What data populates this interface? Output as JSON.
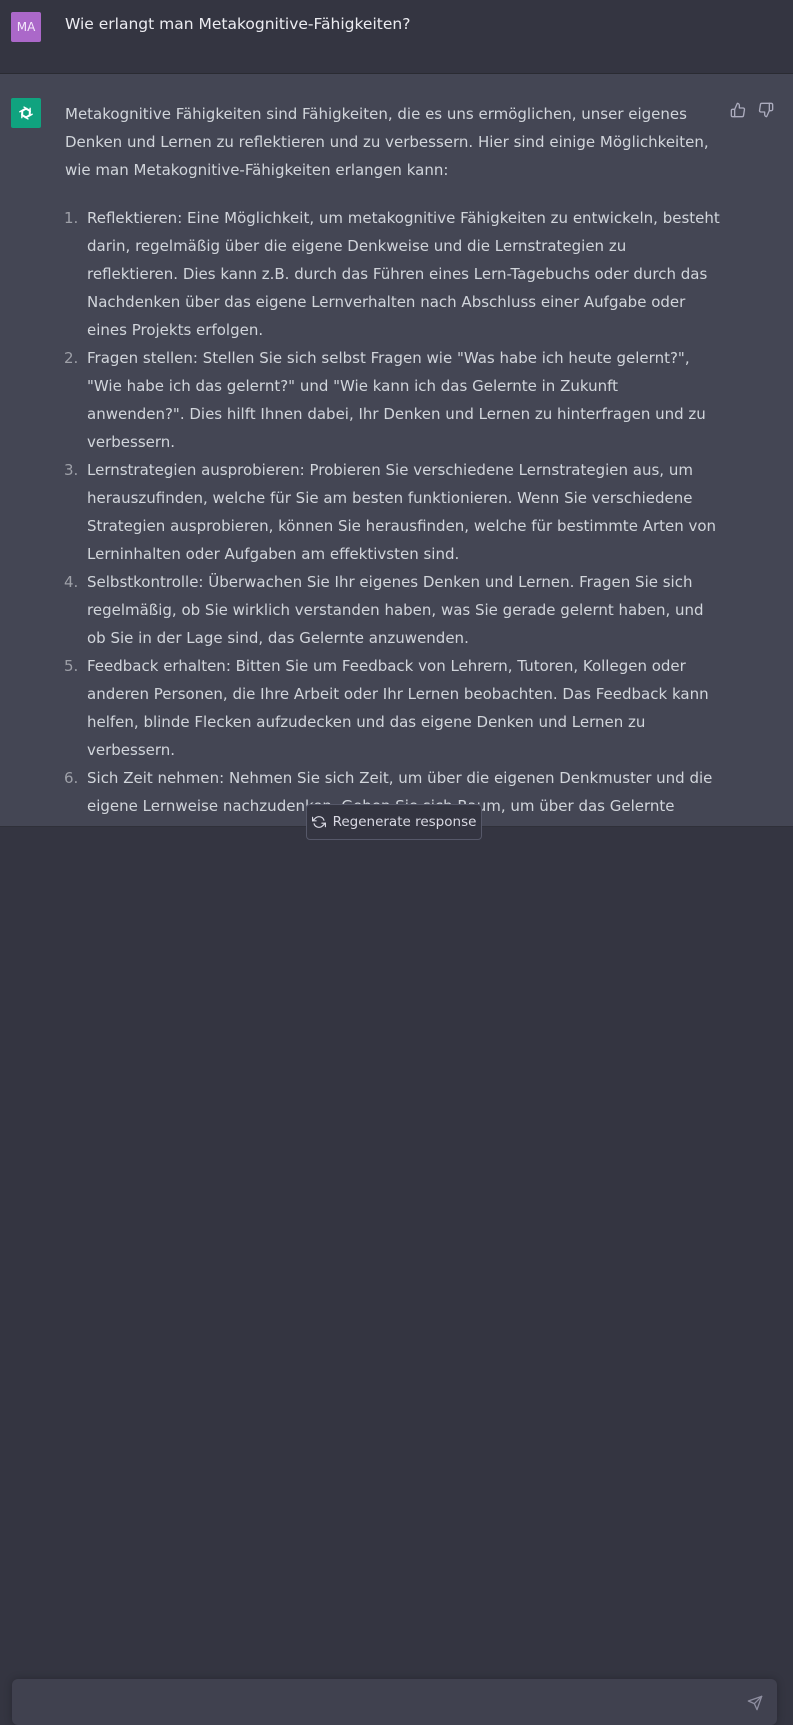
{
  "user": {
    "avatar_initials": "MA",
    "avatar_color": "#ab68c9",
    "message": "Wie erlangt man Metakognitive-Fähigkeiten?"
  },
  "assistant": {
    "avatar_icon": "openai-logo-icon",
    "avatar_color": "#10a37f",
    "intro": "Metakognitive Fähigkeiten sind Fähigkeiten, die es uns ermöglichen, unser eigenes Denken und Lernen zu reflektieren und zu verbessern. Hier sind einige Möglichkeiten, wie man Metakognitive-Fähigkeiten erlangen kann:",
    "items": [
      {
        "num": "1.",
        "text": "Reflektieren: Eine Möglichkeit, um metakognitive Fähigkeiten zu entwickeln, besteht darin, regelmäßig über die eigene Denkweise und die Lernstrategien zu reflektieren. Dies kann z.B. durch das Führen eines Lern-Tagebuchs oder durch das Nachdenken über das eigene Lernverhalten nach Abschluss einer Aufgabe oder eines Projekts erfolgen."
      },
      {
        "num": "2.",
        "text": "Fragen stellen: Stellen Sie sich selbst Fragen wie \"Was habe ich heute gelernt?\", \"Wie habe ich das gelernt?\" und \"Wie kann ich das Gelernte in Zukunft anwenden?\". Dies hilft Ihnen dabei, Ihr Denken und Lernen zu hinterfragen und zu verbessern."
      },
      {
        "num": "3.",
        "text": "Lernstrategien ausprobieren: Probieren Sie verschiedene Lernstrategien aus, um herauszufinden, welche für Sie am besten funktionieren. Wenn Sie verschiedene Strategien ausprobieren, können Sie herausfinden, welche für bestimmte Arten von Lerninhalten oder Aufgaben am effektivsten sind."
      },
      {
        "num": "4.",
        "text": "Selbstkontrolle: Überwachen Sie Ihr eigenes Denken und Lernen. Fragen Sie sich regelmäßig, ob Sie wirklich verstanden haben, was Sie gerade gelernt haben, und ob Sie in der Lage sind, das Gelernte anzuwenden."
      },
      {
        "num": "5.",
        "text": "Feedback erhalten: Bitten Sie um Feedback von Lehrern, Tutoren, Kollegen oder anderen Personen, die Ihre Arbeit oder Ihr Lernen beobachten. Das Feedback kann helfen, blinde Flecken aufzudecken und das eigene Denken und Lernen zu verbessern."
      },
      {
        "num": "6.",
        "text": "Sich Zeit nehmen: Nehmen Sie sich Zeit, um über die eigenen Denkmuster und die eigene Lernweise nachzudenken. Geben Sie sich Raum, um über das Gelernte nachzudenken und sich selbst zu hinterfragen. Metakognition erfordert Zeit und Aufmerksamkeit, um sich zu entwickeln."
      }
    ]
  },
  "actions": {
    "regenerate_label": "Regenerate response",
    "regenerate_icon": "refresh-icon",
    "thumbs_up_icon": "thumbs-up-icon",
    "thumbs_down_icon": "thumbs-down-icon"
  },
  "composer": {
    "placeholder": "",
    "send_icon": "send-icon"
  }
}
